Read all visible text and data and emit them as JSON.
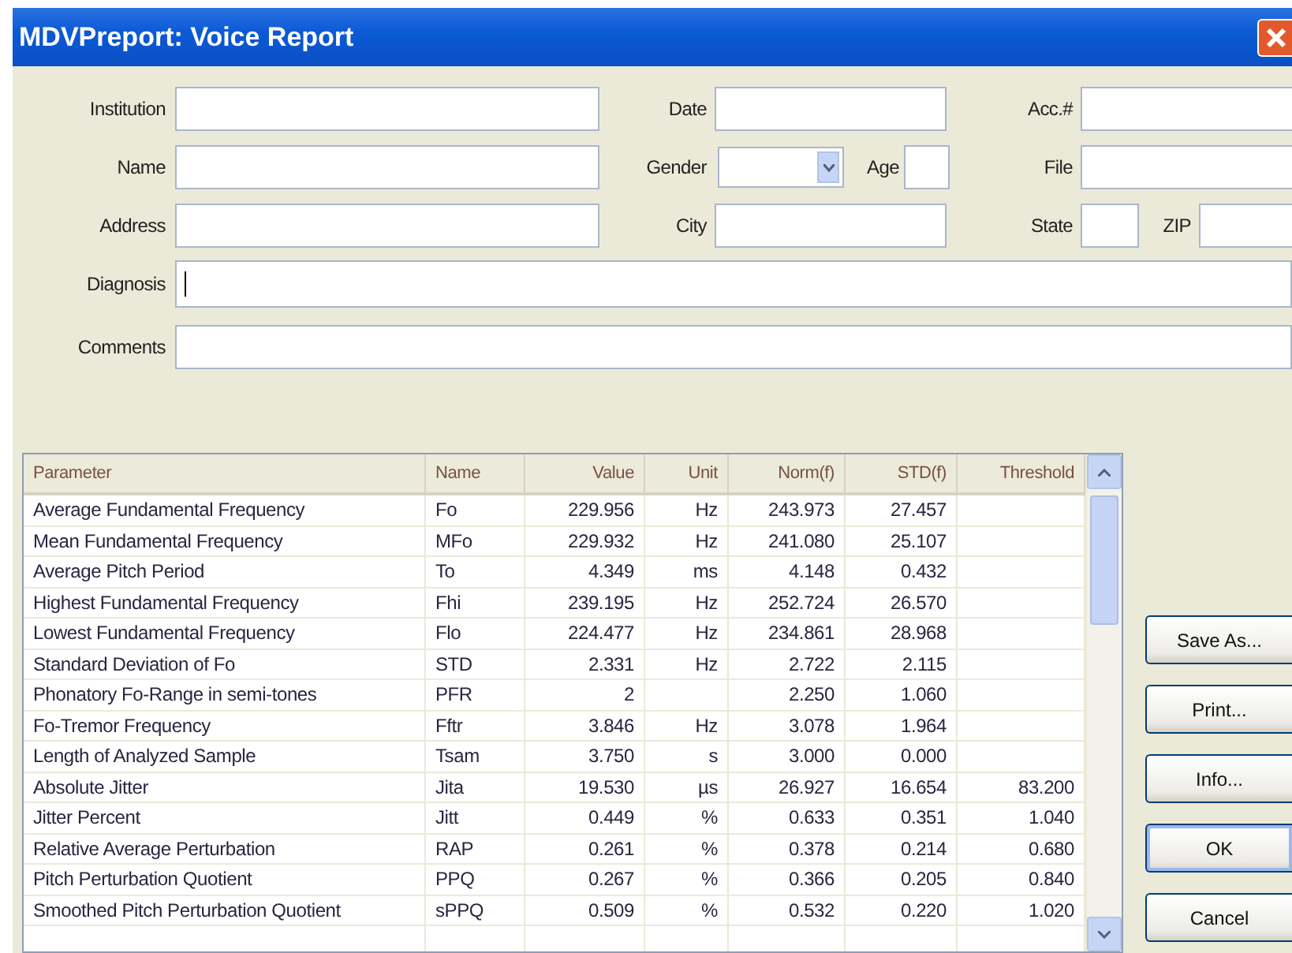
{
  "window": {
    "title": "MDVPreport: Voice Report"
  },
  "form": {
    "rows": [
      {
        "items": [
          {
            "label": "Institution",
            "kind": "text"
          },
          {
            "label": "Date",
            "kind": "text"
          },
          {
            "label": "Acc.#",
            "kind": "text"
          }
        ]
      },
      {
        "items": [
          {
            "label": "Name",
            "kind": "text"
          },
          {
            "label": "Gender",
            "kind": "select"
          },
          {
            "label": "Age",
            "kind": "text"
          },
          {
            "label": "File",
            "kind": "text"
          }
        ]
      },
      {
        "items": [
          {
            "label": "Address",
            "kind": "text"
          },
          {
            "label": "City",
            "kind": "text"
          },
          {
            "label": "State",
            "kind": "text"
          },
          {
            "label": "ZIP",
            "kind": "text"
          }
        ]
      },
      {
        "items": [
          {
            "label": "Diagnosis",
            "kind": "text",
            "focused": true
          }
        ]
      },
      {
        "items": [
          {
            "label": "Comments",
            "kind": "text"
          }
        ]
      }
    ]
  },
  "table": {
    "columns": [
      "Parameter",
      "Name",
      "Value",
      "Unit",
      "Norm(f)",
      "STD(f)",
      "Threshold"
    ],
    "rows": [
      {
        "cells": [
          "Average Fundamental Frequency",
          "Fo",
          "229.956",
          "Hz",
          "243.973",
          "27.457",
          null
        ]
      },
      {
        "cells": [
          "Mean Fundamental Frequency",
          "MFo",
          "229.932",
          "Hz",
          "241.080",
          "25.107",
          null
        ]
      },
      {
        "cells": [
          "Average Pitch Period",
          "To",
          "4.349",
          "ms",
          "4.148",
          "0.432",
          null
        ]
      },
      {
        "cells": [
          "Highest Fundamental Frequency",
          "Fhi",
          "239.195",
          "Hz",
          "252.724",
          "26.570",
          null
        ]
      },
      {
        "cells": [
          "Lowest Fundamental Frequency",
          "Flo",
          "224.477",
          "Hz",
          "234.861",
          "28.968",
          null
        ]
      },
      {
        "cells": [
          "Standard Deviation of Fo",
          "STD",
          "2.331",
          "Hz",
          "2.722",
          "2.115",
          null
        ]
      },
      {
        "cells": [
          "Phonatory Fo-Range in semi-tones",
          "PFR",
          "2",
          null,
          "2.250",
          "1.060",
          null
        ]
      },
      {
        "cells": [
          "Fo-Tremor Frequency",
          "Fftr",
          "3.846",
          "Hz",
          "3.078",
          "1.964",
          null
        ]
      },
      {
        "cells": [
          "Length of Analyzed Sample",
          "Tsam",
          "3.750",
          "s",
          "3.000",
          "0.000",
          null
        ]
      },
      {
        "cells": [
          "Absolute Jitter",
          "Jita",
          "19.530",
          "µs",
          "26.927",
          "16.654",
          "83.200"
        ]
      },
      {
        "cells": [
          "Jitter Percent",
          "Jitt",
          "0.449",
          "%",
          "0.633",
          "0.351",
          "1.040"
        ]
      },
      {
        "cells": [
          "Relative Average Perturbation",
          "RAP",
          "0.261",
          "%",
          "0.378",
          "0.214",
          "0.680"
        ]
      },
      {
        "cells": [
          "Pitch Perturbation Quotient",
          "PPQ",
          "0.267",
          "%",
          "0.366",
          "0.205",
          "0.840"
        ]
      },
      {
        "cells": [
          "Smoothed Pitch Perturbation Quotient",
          "sPPQ",
          "0.509",
          "%",
          "0.532",
          "0.220",
          "1.020"
        ]
      }
    ]
  },
  "buttons": [
    {
      "label": "Save As...",
      "default": false
    },
    {
      "label": "Print...",
      "default": false
    },
    {
      "label": "Info...",
      "default": false
    },
    {
      "label": "OK",
      "default": true
    },
    {
      "label": "Cancel",
      "default": false
    }
  ]
}
